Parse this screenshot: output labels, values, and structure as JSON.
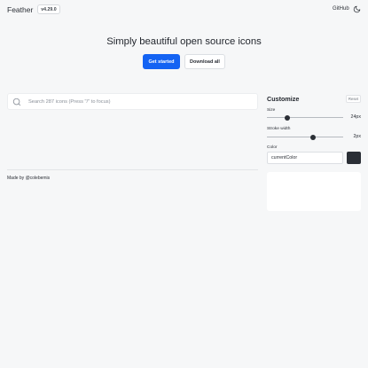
{
  "header": {
    "brand": "Feather",
    "version": "v4.29.0",
    "github_label": "GitHub",
    "theme_icon": "moon-icon"
  },
  "hero": {
    "title": "Simply beautiful open source icons",
    "primary_button": "Get started",
    "secondary_button": "Download all"
  },
  "search": {
    "placeholder": "Search 287 icons (Press \"/\" to focus)",
    "value": "",
    "icon": "search-icon"
  },
  "footer": {
    "made_by_prefix": "Made by ",
    "made_by_link": "@colebemis"
  },
  "customize": {
    "title": "Customize",
    "reset_label": "Reset",
    "size": {
      "label": "Size",
      "value_label": "24px",
      "value": 24,
      "min": 12,
      "max": 56
    },
    "stroke": {
      "label": "Stroke width",
      "value_label": "2px",
      "value": 2,
      "min": 0.5,
      "max": 3
    },
    "color": {
      "label": "Color",
      "value": "currentColor",
      "swatch": "#2b2f36"
    }
  },
  "colors": {
    "accent": "#1463f3",
    "text": "#23272e",
    "background": "#f6f7f8"
  }
}
